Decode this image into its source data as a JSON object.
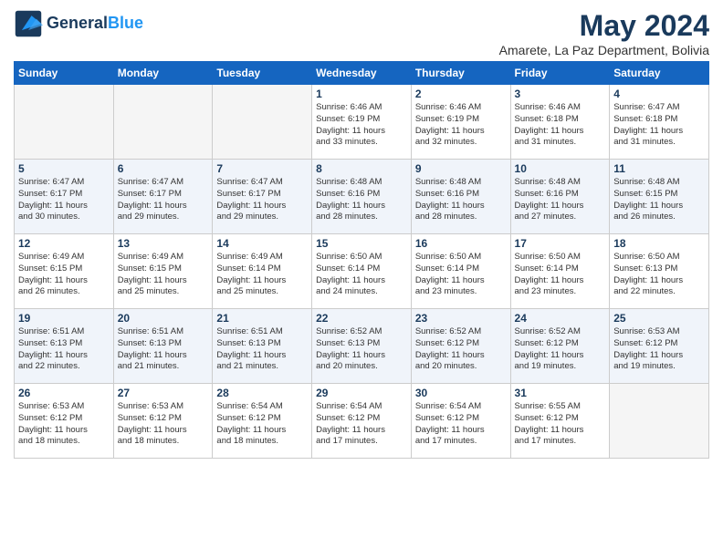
{
  "logo": {
    "line1": "General",
    "line2": "Blue"
  },
  "title": "May 2024",
  "subtitle": "Amarete, La Paz Department, Bolivia",
  "weekdays": [
    "Sunday",
    "Monday",
    "Tuesday",
    "Wednesday",
    "Thursday",
    "Friday",
    "Saturday"
  ],
  "weeks": [
    [
      {
        "day": "",
        "empty": true
      },
      {
        "day": "",
        "empty": true
      },
      {
        "day": "",
        "empty": true
      },
      {
        "day": "1",
        "info": "Sunrise: 6:46 AM\nSunset: 6:19 PM\nDaylight: 11 hours\nand 33 minutes."
      },
      {
        "day": "2",
        "info": "Sunrise: 6:46 AM\nSunset: 6:19 PM\nDaylight: 11 hours\nand 32 minutes."
      },
      {
        "day": "3",
        "info": "Sunrise: 6:46 AM\nSunset: 6:18 PM\nDaylight: 11 hours\nand 31 minutes."
      },
      {
        "day": "4",
        "info": "Sunrise: 6:47 AM\nSunset: 6:18 PM\nDaylight: 11 hours\nand 31 minutes."
      }
    ],
    [
      {
        "day": "5",
        "info": "Sunrise: 6:47 AM\nSunset: 6:17 PM\nDaylight: 11 hours\nand 30 minutes."
      },
      {
        "day": "6",
        "info": "Sunrise: 6:47 AM\nSunset: 6:17 PM\nDaylight: 11 hours\nand 29 minutes."
      },
      {
        "day": "7",
        "info": "Sunrise: 6:47 AM\nSunset: 6:17 PM\nDaylight: 11 hours\nand 29 minutes."
      },
      {
        "day": "8",
        "info": "Sunrise: 6:48 AM\nSunset: 6:16 PM\nDaylight: 11 hours\nand 28 minutes."
      },
      {
        "day": "9",
        "info": "Sunrise: 6:48 AM\nSunset: 6:16 PM\nDaylight: 11 hours\nand 28 minutes."
      },
      {
        "day": "10",
        "info": "Sunrise: 6:48 AM\nSunset: 6:16 PM\nDaylight: 11 hours\nand 27 minutes."
      },
      {
        "day": "11",
        "info": "Sunrise: 6:48 AM\nSunset: 6:15 PM\nDaylight: 11 hours\nand 26 minutes."
      }
    ],
    [
      {
        "day": "12",
        "info": "Sunrise: 6:49 AM\nSunset: 6:15 PM\nDaylight: 11 hours\nand 26 minutes."
      },
      {
        "day": "13",
        "info": "Sunrise: 6:49 AM\nSunset: 6:15 PM\nDaylight: 11 hours\nand 25 minutes."
      },
      {
        "day": "14",
        "info": "Sunrise: 6:49 AM\nSunset: 6:14 PM\nDaylight: 11 hours\nand 25 minutes."
      },
      {
        "day": "15",
        "info": "Sunrise: 6:50 AM\nSunset: 6:14 PM\nDaylight: 11 hours\nand 24 minutes."
      },
      {
        "day": "16",
        "info": "Sunrise: 6:50 AM\nSunset: 6:14 PM\nDaylight: 11 hours\nand 23 minutes."
      },
      {
        "day": "17",
        "info": "Sunrise: 6:50 AM\nSunset: 6:14 PM\nDaylight: 11 hours\nand 23 minutes."
      },
      {
        "day": "18",
        "info": "Sunrise: 6:50 AM\nSunset: 6:13 PM\nDaylight: 11 hours\nand 22 minutes."
      }
    ],
    [
      {
        "day": "19",
        "info": "Sunrise: 6:51 AM\nSunset: 6:13 PM\nDaylight: 11 hours\nand 22 minutes."
      },
      {
        "day": "20",
        "info": "Sunrise: 6:51 AM\nSunset: 6:13 PM\nDaylight: 11 hours\nand 21 minutes."
      },
      {
        "day": "21",
        "info": "Sunrise: 6:51 AM\nSunset: 6:13 PM\nDaylight: 11 hours\nand 21 minutes."
      },
      {
        "day": "22",
        "info": "Sunrise: 6:52 AM\nSunset: 6:13 PM\nDaylight: 11 hours\nand 20 minutes."
      },
      {
        "day": "23",
        "info": "Sunrise: 6:52 AM\nSunset: 6:12 PM\nDaylight: 11 hours\nand 20 minutes."
      },
      {
        "day": "24",
        "info": "Sunrise: 6:52 AM\nSunset: 6:12 PM\nDaylight: 11 hours\nand 19 minutes."
      },
      {
        "day": "25",
        "info": "Sunrise: 6:53 AM\nSunset: 6:12 PM\nDaylight: 11 hours\nand 19 minutes."
      }
    ],
    [
      {
        "day": "26",
        "info": "Sunrise: 6:53 AM\nSunset: 6:12 PM\nDaylight: 11 hours\nand 18 minutes."
      },
      {
        "day": "27",
        "info": "Sunrise: 6:53 AM\nSunset: 6:12 PM\nDaylight: 11 hours\nand 18 minutes."
      },
      {
        "day": "28",
        "info": "Sunrise: 6:54 AM\nSunset: 6:12 PM\nDaylight: 11 hours\nand 18 minutes."
      },
      {
        "day": "29",
        "info": "Sunrise: 6:54 AM\nSunset: 6:12 PM\nDaylight: 11 hours\nand 17 minutes."
      },
      {
        "day": "30",
        "info": "Sunrise: 6:54 AM\nSunset: 6:12 PM\nDaylight: 11 hours\nand 17 minutes."
      },
      {
        "day": "31",
        "info": "Sunrise: 6:55 AM\nSunset: 6:12 PM\nDaylight: 11 hours\nand 17 minutes."
      },
      {
        "day": "",
        "empty": true
      }
    ]
  ]
}
